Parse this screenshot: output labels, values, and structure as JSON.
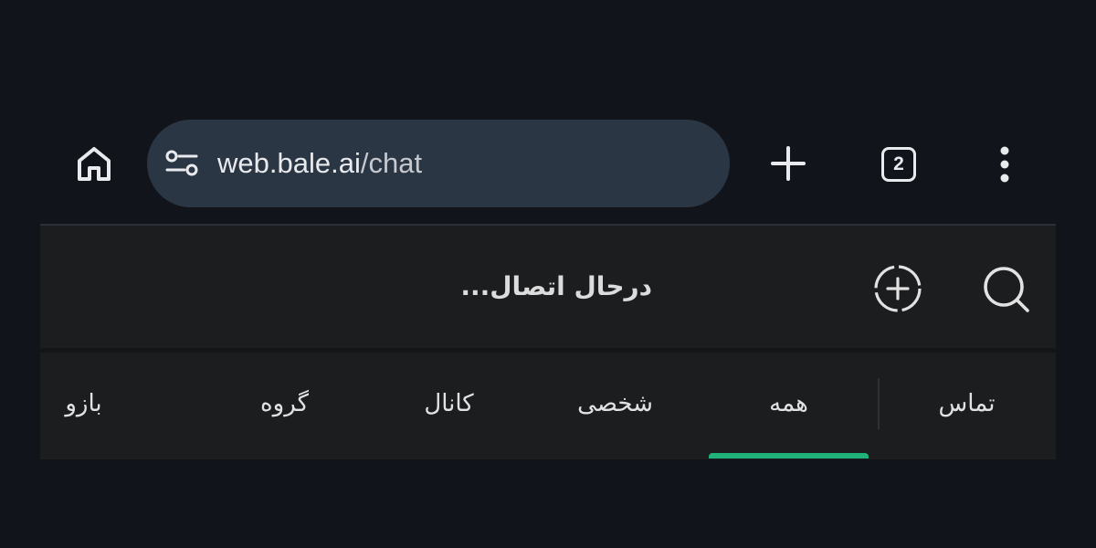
{
  "browser": {
    "url_host": "web.bale.ai",
    "url_path": "/chat",
    "tab_count": "2",
    "icons": {
      "home": "home-icon",
      "site_settings": "tune-icon",
      "new_tab": "plus-icon",
      "menu": "more-vert-icon"
    }
  },
  "app": {
    "header": {
      "title": "درحال اتصال..."
    },
    "icons": {
      "new_chat": "add-circle-dashed-icon",
      "search": "search-icon"
    },
    "tabs": [
      {
        "label": "تماس"
      },
      {
        "label": "همه",
        "active": true
      },
      {
        "label": "شخصی"
      },
      {
        "label": "کانال"
      },
      {
        "label": "گروه"
      },
      {
        "label": "بازو"
      }
    ],
    "accent_color": "#1fb37a"
  },
  "colors": {
    "background": "#11151b",
    "omnibox": "#2b3644",
    "app_surface": "#1c1d1f",
    "text": "#e2e2e2"
  }
}
